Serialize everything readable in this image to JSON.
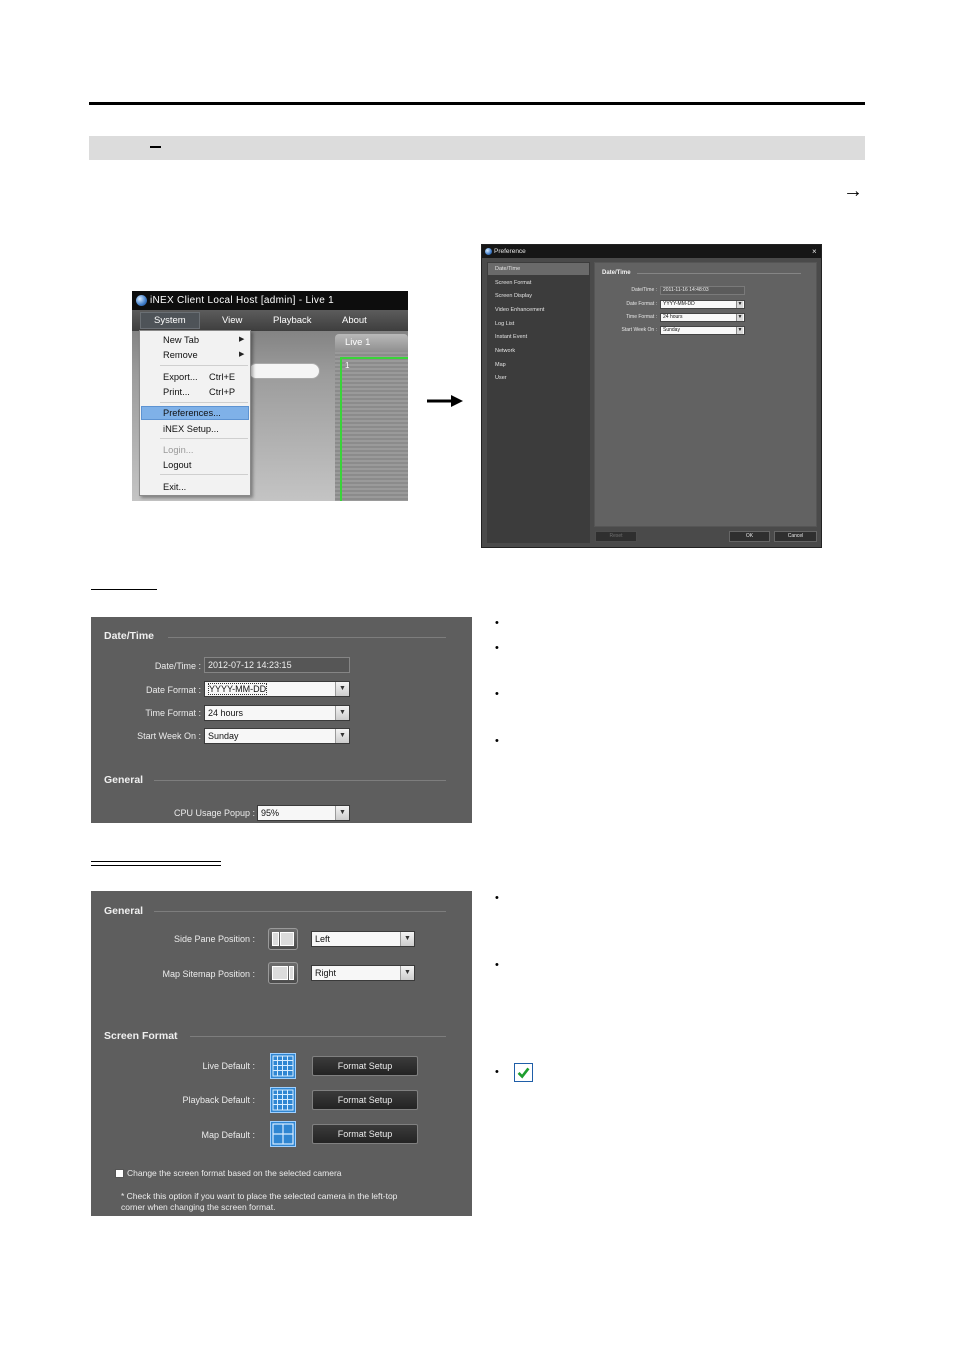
{
  "page": {
    "band_dash": "–",
    "arrow_glyph": "→"
  },
  "menu_screenshot": {
    "title": "iNEX Client Local Host [admin] - Live  1",
    "menubar": [
      "System",
      "View",
      "Playback",
      "About"
    ],
    "tab_label": "Live  1",
    "pane_number": "1",
    "items": [
      {
        "label": "New Tab",
        "shortcut": "",
        "submenu": true,
        "disabled": false
      },
      {
        "label": "Remove",
        "shortcut": "",
        "submenu": true,
        "disabled": false
      },
      {
        "label": "Export...",
        "shortcut": "Ctrl+E",
        "submenu": false,
        "disabled": false
      },
      {
        "label": "Print...",
        "shortcut": "Ctrl+P",
        "submenu": false,
        "disabled": false
      },
      {
        "label": "Preferences...",
        "shortcut": "",
        "submenu": false,
        "disabled": false
      },
      {
        "label": "iNEX Setup...",
        "shortcut": "",
        "submenu": false,
        "disabled": false
      },
      {
        "label": "Login...",
        "shortcut": "",
        "submenu": false,
        "disabled": true
      },
      {
        "label": "Logout",
        "shortcut": "",
        "submenu": false,
        "disabled": false
      },
      {
        "label": "Exit...",
        "shortcut": "",
        "submenu": false,
        "disabled": false
      }
    ],
    "highlighted_item": "Preferences..."
  },
  "preference_dialog": {
    "title": "Preference",
    "close_glyph": "×",
    "sidebar": [
      "Date/Time",
      "Screen Format",
      "Screen Display",
      "Video Enhancement",
      "Log List",
      "Instant Event",
      "Network",
      "Map",
      "User"
    ],
    "section_title": "Date/Time",
    "fields": {
      "datetime_label": "Date/Time :",
      "datetime_value": "2011-11-16  14:48:03",
      "date_format_label": "Date Format :",
      "date_format_value": "YYYY-MM-DD",
      "time_format_label": "Time Format :",
      "time_format_value": "24 hours",
      "start_week_label": "Start Week On :",
      "start_week_value": "Sunday"
    },
    "buttons": {
      "reset": "Reset",
      "ok": "OK",
      "cancel": "Cancel"
    }
  },
  "datetime_panel": {
    "section1": "Date/Time",
    "datetime_label": "Date/Time :",
    "datetime_value": "2012-07-12  14:23:15",
    "date_format_label": "Date Format :",
    "date_format_value": "YYYY-MM-DD",
    "time_format_label": "Time Format :",
    "time_format_value": "24 hours",
    "start_week_label": "Start Week On :",
    "start_week_value": "Sunday",
    "section2": "General",
    "cpu_label": "CPU Usage Popup :",
    "cpu_value": "95%"
  },
  "screen_format_panel": {
    "section1": "General",
    "side_pane_label": "Side Pane Position :",
    "side_pane_value": "Left",
    "sitemap_label": "Map Sitemap Position :",
    "sitemap_value": "Right",
    "section2": "Screen Format",
    "live_label": "Live Default :",
    "playback_label": "Playback Default :",
    "map_label": "Map Default :",
    "format_button": "Format Setup",
    "checkbox_label": "Change the screen format based on the selected camera",
    "note_line1": "* Check this option if you want to place the selected camera in the left-top",
    "note_line2": "corner when changing the screen format."
  },
  "bullets": {
    "glyph": "•"
  },
  "colors": {
    "accent_blue": "#2f86d2",
    "highlight": "#7fb1e8",
    "live_border": "#39d439",
    "check_green": "#1e9e2e"
  }
}
